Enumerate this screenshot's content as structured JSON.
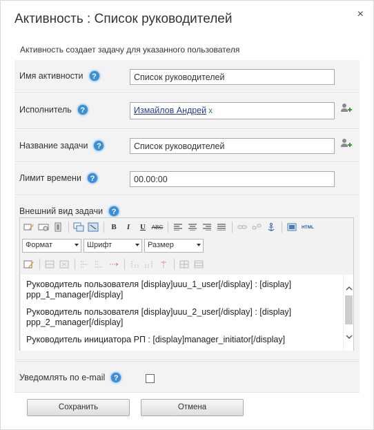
{
  "dialog": {
    "title": "Активность : Список руководителей",
    "close": "×",
    "description": "Активность создает задачу для указанного пользователя"
  },
  "fields": {
    "activity_name": {
      "label": "Имя активности",
      "value": "Список руководителей"
    },
    "executor": {
      "label": "Исполнитель",
      "user": "Измайлов Андрей",
      "remove": "x"
    },
    "task_name": {
      "label": "Название задачи",
      "value": "Список руководителей"
    },
    "time_limit": {
      "label": "Лимит времени",
      "value": "00.00:00"
    },
    "task_view": {
      "label": "Внешний вид задачи"
    },
    "notify_email": {
      "label": "Уведомлять по e-mail",
      "checked": false
    }
  },
  "help_symbol": "?",
  "editor": {
    "bold": "B",
    "italic": "I",
    "underline": "U",
    "strike": "ABC",
    "html": "HTML",
    "format_select": "Формат",
    "font_select": "Шрифт",
    "size_select": "Размер",
    "content": [
      "Руководитель пользователя [display]uuu_1_user[/display] : [display] ppp_1_manager[/display]",
      "Руководитель пользователя [display]uuu_2_user[/display] : [display] ppp_2_manager[/display]",
      "Руководитель инициатора РП : [display]manager_initiator[/display]"
    ]
  },
  "buttons": {
    "save": "Сохранить",
    "cancel": "Отмена"
  },
  "colors": {
    "help_icon": "#3c8ed8",
    "row_bg": "#f3f3f3",
    "link": "#2b3e8a",
    "remove_x": "#2f8c4a"
  }
}
